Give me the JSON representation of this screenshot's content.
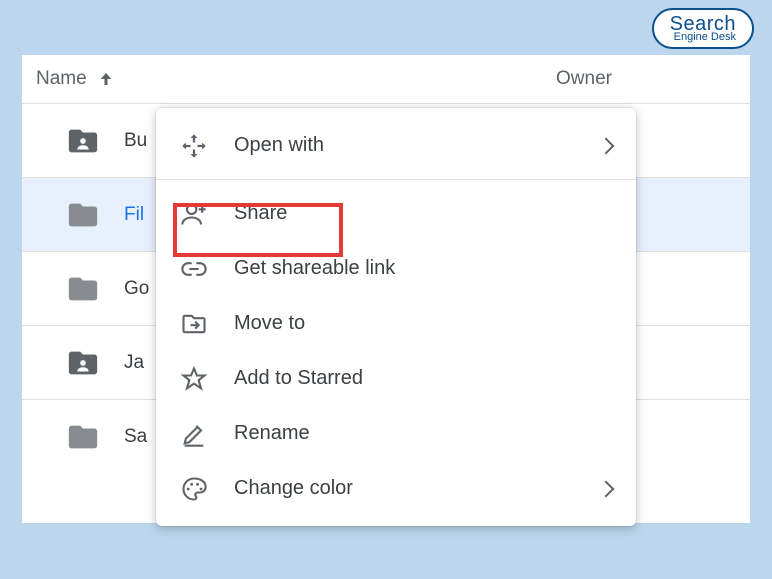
{
  "logo": {
    "main": "Search",
    "sub": "Engine Desk"
  },
  "header": {
    "name": "Name",
    "owner": "Owner"
  },
  "rows": [
    {
      "name": "Bu",
      "selected": false,
      "shared": true
    },
    {
      "name": "Fil",
      "selected": true,
      "shared": false
    },
    {
      "name": "Go",
      "selected": false,
      "shared": false
    },
    {
      "name": "Ja",
      "selected": false,
      "shared": true
    },
    {
      "name": "Sa",
      "selected": false,
      "shared": false
    }
  ],
  "menu": {
    "open_with": "Open with",
    "share": "Share",
    "get_link": "Get shareable link",
    "move_to": "Move to",
    "starred": "Add to Starred",
    "rename": "Rename",
    "color": "Change color"
  }
}
